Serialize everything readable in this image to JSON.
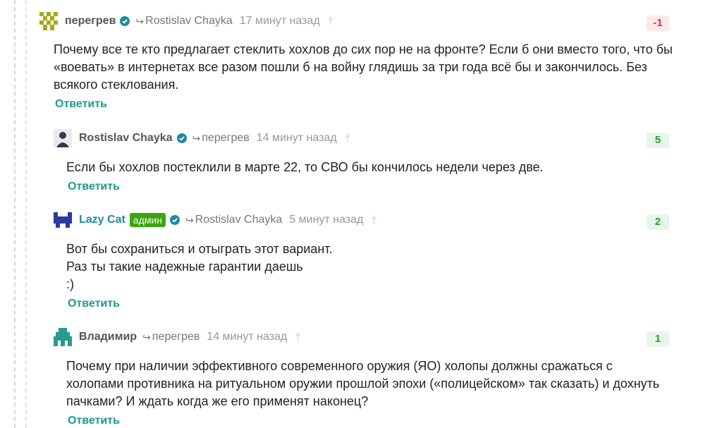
{
  "comments": [
    {
      "author": "перегрев",
      "reply_to": "Rostislav Chayka",
      "time": "17 минут назад",
      "score": "-1",
      "lines": [
        "Почему все те кто предлагает стеклить хохлов до сих пор не на фронте? Если б они вместо того, что бы",
        "«воевать» в интернетах все разом пошли б на войну глядишь за три года всё бы и закончилось. Без",
        "всякого стеклования."
      ],
      "reply_label": "Ответить"
    },
    {
      "author": "Rostislav Chayka",
      "reply_to": "перегрев",
      "time": "14 минут назад",
      "score": "5",
      "lines": [
        "Если бы хохлов постеклили в марте 22, то СВО бы кончилось недели через две."
      ],
      "reply_label": "Ответить"
    },
    {
      "author": "Lazy Cat",
      "badge": "админ",
      "reply_to": "Rostislav Chayka",
      "time": "5 минут назад",
      "score": "2",
      "lines": [
        "Вот бы сохраниться и отыграть этот вариант.",
        "Раз ты такие надежные гарантии даешь",
        ":)"
      ],
      "reply_label": "Ответить"
    },
    {
      "author": "Владимир",
      "reply_to": "перегрев",
      "time": "14 минут назад",
      "score": "1",
      "lines": [
        "Почему при наличии эффективного современного оружия (ЯО) холопы должны сражаться с",
        "холопами противника на ритуальном оружии прошлой эпохи («полицейском» так сказать) и дохнуть",
        "пачками? И ждать когда же его применят наконец?"
      ],
      "reply_label": "Ответить"
    }
  ],
  "icons": {
    "verified": "verified-check-icon",
    "reply_arrow": "reply-arrow-icon",
    "up": "scroll-to-parent-icon"
  },
  "colors": {
    "accent_teal": "#1e9a8c",
    "admin_green": "#3aa60c",
    "negative": "#d13b3b",
    "positive": "#2e9a3a"
  }
}
